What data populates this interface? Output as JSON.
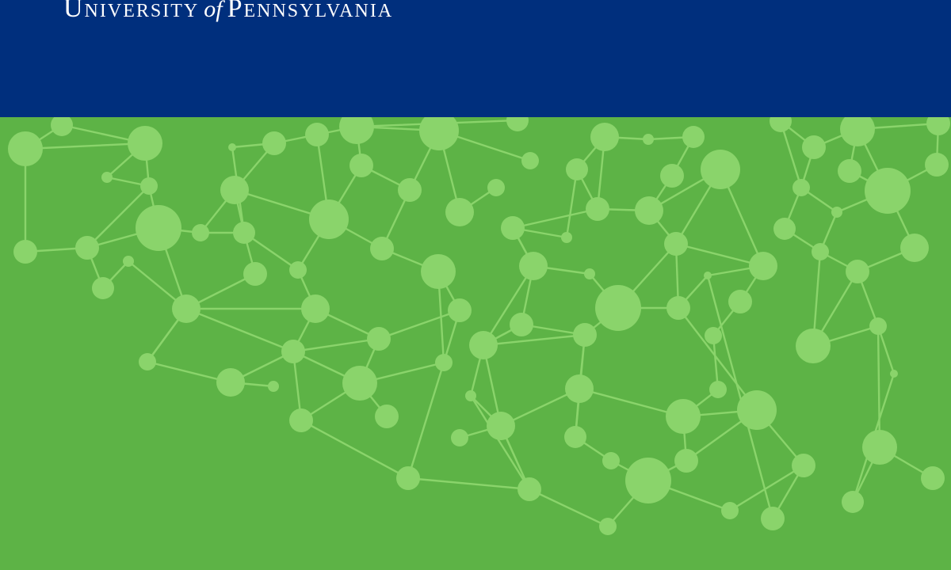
{
  "header": {
    "wordmark": {
      "word1": "University",
      "word2": "of",
      "word3": "Pennsylvania"
    }
  },
  "colors": {
    "header_bg": "#002f7d",
    "background": "#5db346",
    "network": "#8ad46b",
    "wordmark_text": "#ffffff"
  },
  "decoration": {
    "name": "network-graph-pattern"
  }
}
